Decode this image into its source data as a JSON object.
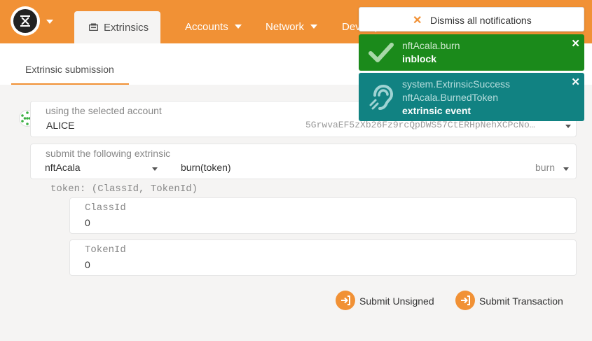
{
  "header": {
    "tabs": [
      {
        "label": "Extrinsics",
        "active": true
      },
      {
        "label": "Accounts"
      },
      {
        "label": "Network"
      },
      {
        "label": "Developer"
      }
    ]
  },
  "subnav": {
    "active_tab": "Extrinsic submission"
  },
  "account": {
    "label": "using the selected account",
    "name": "ALICE",
    "address": "5GrwvaEF5zXb26Fz9rcQpDWS57CtERHpNehXCPcNo…"
  },
  "extrinsic": {
    "label": "submit the following extrinsic",
    "module": "nftAcala",
    "method": "burn(token)",
    "method_short": "burn"
  },
  "params": {
    "signature": "token: (ClassId, TokenId)",
    "class_id_label": "ClassId",
    "class_id_value": "0",
    "token_id_label": "TokenId",
    "token_id_value": "0"
  },
  "actions": {
    "submit_unsigned": "Submit Unsigned",
    "submit_transaction": "Submit Transaction"
  },
  "notifications": {
    "dismiss_label": "Dismiss all notifications",
    "items": [
      {
        "line1": "nftAcala.burn",
        "status": "inblock",
        "icon": "check-icon",
        "color": "#1b8a1b"
      },
      {
        "line1": "system.ExtrinsicSuccess",
        "line2": "nftAcala.BurnedToken",
        "status": "extrinsic event",
        "icon": "ear-icon",
        "color": "#118282"
      }
    ]
  },
  "colors": {
    "accent": "#f19135"
  }
}
